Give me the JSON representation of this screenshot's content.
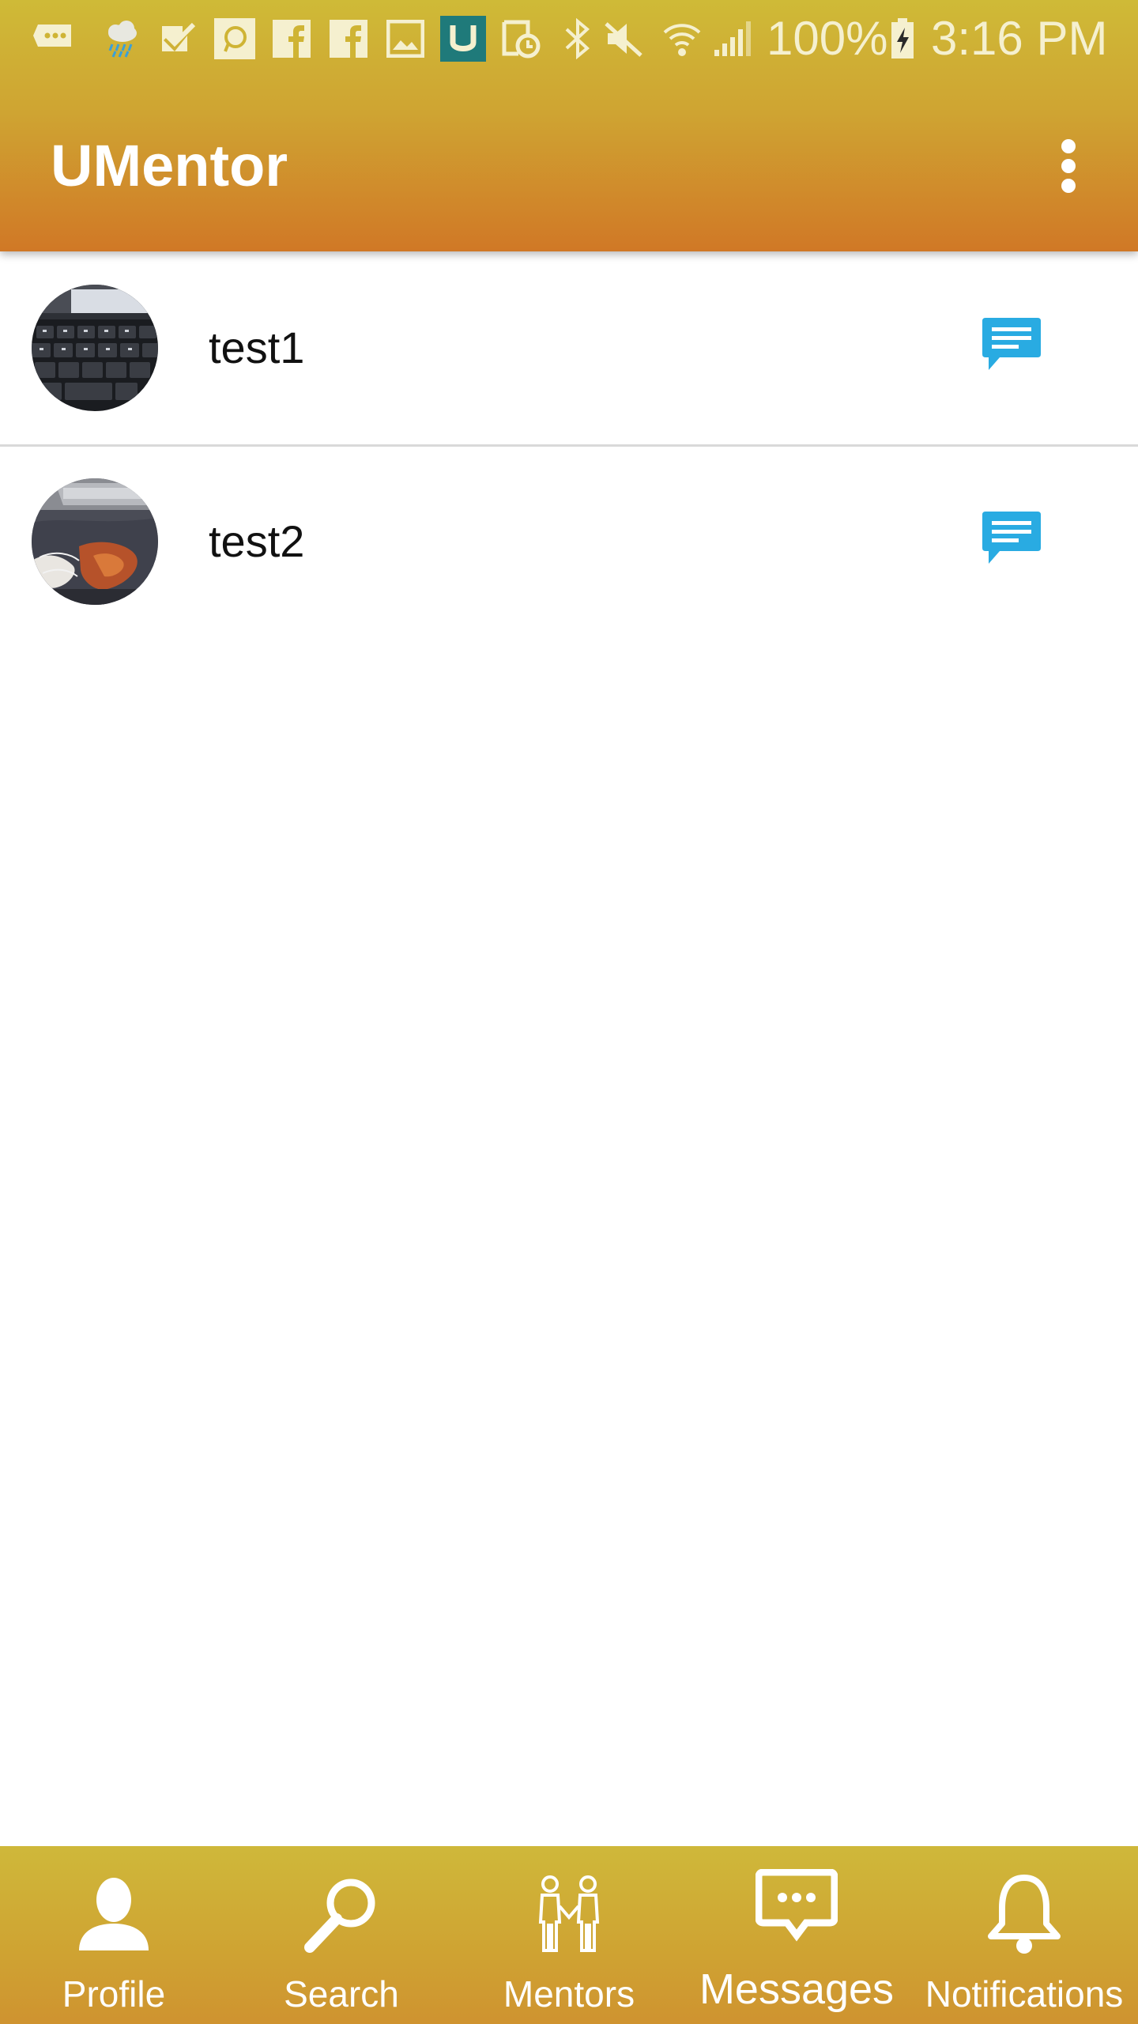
{
  "status_bar": {
    "battery": "100%",
    "time": "3:16 PM",
    "icons": [
      "message-notification-icon",
      "weather-rain-icon",
      "task-check-icon",
      "chat-app-icon",
      "facebook-icon",
      "facebook-icon",
      "gallery-icon",
      "umentor-app-icon",
      "calendar-reminder-icon",
      "bluetooth-icon",
      "muted-icon",
      "wifi-icon",
      "cell-signal-icon",
      "battery-charging-icon"
    ]
  },
  "app_bar": {
    "title": "UMentor",
    "menu_icon": "more-vert-icon"
  },
  "conversations": [
    {
      "name": "test1",
      "avatar": "keyboard-photo",
      "action_icon": "chat-message-icon"
    },
    {
      "name": "test2",
      "avatar": "desk-photo",
      "action_icon": "chat-message-icon"
    }
  ],
  "bottom_nav": {
    "items": [
      {
        "label": "Profile",
        "icon": "person-icon"
      },
      {
        "label": "Search",
        "icon": "search-icon"
      },
      {
        "label": "Mentors",
        "icon": "mentors-icon"
      },
      {
        "label": "Messages",
        "icon": "messages-icon"
      },
      {
        "label": "Notifications",
        "icon": "bell-icon"
      }
    ],
    "active": "Messages"
  },
  "colors": {
    "header_gradient_top": "#cfba37",
    "header_gradient_bottom": "#d07826",
    "accent_chat_icon": "#29abe2",
    "nav_bar": "#cfa332"
  }
}
